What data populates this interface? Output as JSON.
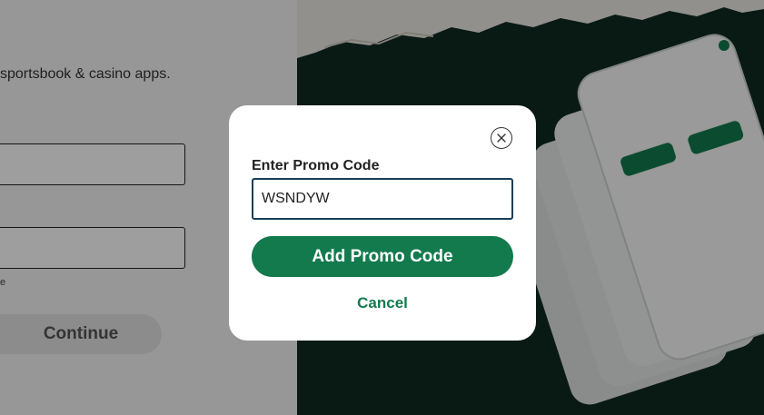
{
  "background_form": {
    "subtitle": "sportsbook & casino apps.",
    "field_hint": "e",
    "continue_label": "Continue"
  },
  "modal": {
    "label": "Enter Promo Code",
    "promo_value": "WSNDYW",
    "add_button_label": "Add Promo Code",
    "cancel_label": "Cancel",
    "close_icon": "close-icon"
  },
  "colors": {
    "brand_green": "#137a4d",
    "input_border": "#173f58",
    "hero_bg": "#0f2a22"
  }
}
